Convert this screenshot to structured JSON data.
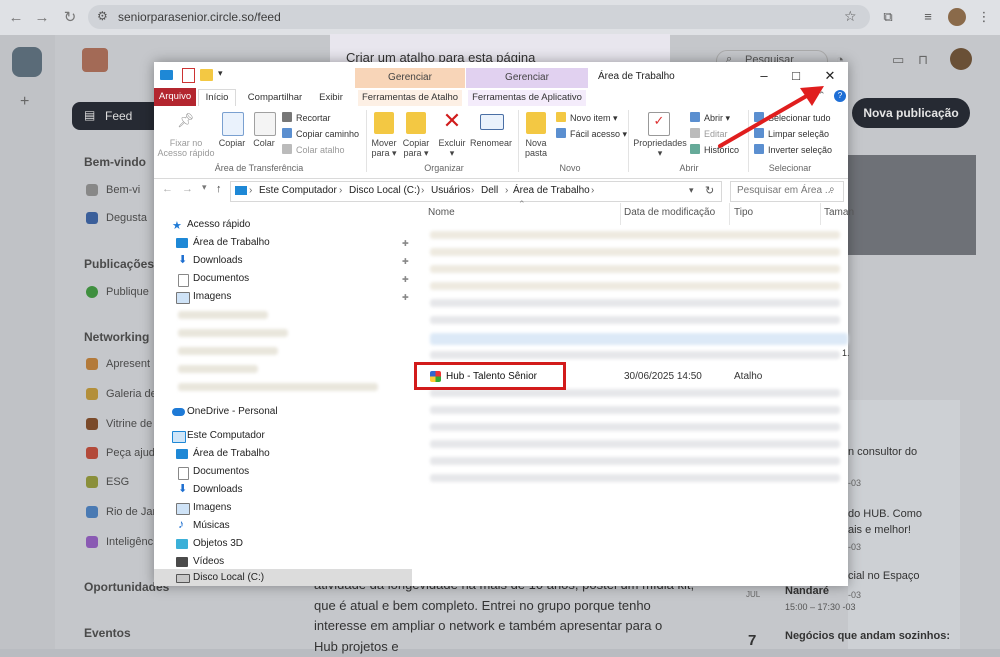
{
  "browser": {
    "url": "seniorparasenior.circle.so/feed"
  },
  "site": {
    "popup_title": "Criar um atalho para esta página",
    "search_placeholder": "Pesquisar",
    "new_post": "Nova publicação",
    "nav": {
      "feed": "Feed",
      "sections": [
        {
          "title": "Bem-vindo",
          "items": [
            "Bem-vi",
            "Degusta"
          ]
        },
        {
          "title": "Publicações",
          "items": [
            "Publique"
          ]
        },
        {
          "title": "Networking",
          "items": [
            "Apresent",
            "Galeria de",
            "Vitrine de",
            "Peça ajud",
            "ESG",
            "Rio de Jan",
            "Inteligênc"
          ]
        },
        {
          "title": "Oportunidades",
          "items": []
        },
        {
          "title": "Eventos",
          "items": []
        }
      ]
    },
    "post_text": [
      "atividade da longevidade há mais de 10 anos, postei um mídia kit,",
      "que é atual e bem completo. Entrei no grupo porque tenho",
      "interesse em ampliar o network e também apresentar para o",
      "Hub projetos e"
    ],
    "right_panel": {
      "lines": [
        "n consultor do",
        "-03",
        "do HUB. Como",
        "ais e melhor!",
        "-03",
        "cial no Espaço",
        "-03"
      ],
      "event_title": "Nandaré",
      "event_time": "15:00 – 17:30 -03",
      "event_month": "JUL",
      "event2_day": "7",
      "event2_title": "Negócios que andam sozinhos:"
    }
  },
  "explorer": {
    "window_title": "Área de Trabalho",
    "context_tabs": [
      {
        "group": "Gerenciar",
        "tab": "Ferramentas de Atalho"
      },
      {
        "group": "Gerenciar",
        "tab": "Ferramentas de Aplicativo"
      }
    ],
    "ribbon_tabs": [
      "Arquivo",
      "Início",
      "Compartilhar",
      "Exibir"
    ],
    "ribbon": {
      "clipboard": {
        "pin": "Fixar no Acesso rápido",
        "copy": "Copiar",
        "paste": "Colar",
        "cut": "Recortar",
        "copy_path": "Copiar caminho",
        "paste_shortcut": "Colar atalho",
        "group": "Área de Transferência"
      },
      "organize": {
        "move": "Mover para",
        "copy_to": "Copiar para",
        "delete": "Excluir",
        "rename": "Renomear",
        "group": "Organizar"
      },
      "new": {
        "new_folder": "Nova pasta",
        "new_item": "Novo item",
        "easy_access": "Fácil acesso",
        "group": "Novo"
      },
      "open": {
        "properties": "Propriedades",
        "open": "Abrir",
        "edit": "Editar",
        "history": "Histórico",
        "group": "Abrir"
      },
      "select": {
        "select_all": "Selecionar tudo",
        "select_none": "Limpar seleção",
        "invert": "Inverter seleção",
        "group": "Selecionar"
      }
    },
    "breadcrumb": [
      "Este Computador",
      "Disco Local (C:)",
      "Usuários",
      "Dell",
      "Área de Trabalho"
    ],
    "search_placeholder": "Pesquisar em Área ...",
    "nav_pane": {
      "quick_access": "Acesso rápido",
      "quick_items": [
        "Área de Trabalho",
        "Downloads",
        "Documentos",
        "Imagens"
      ],
      "onedrive": "OneDrive - Personal",
      "this_pc": "Este Computador",
      "pc_items": [
        "Área de Trabalho",
        "Documentos",
        "Downloads",
        "Imagens",
        "Músicas",
        "Objetos 3D",
        "Vídeos",
        "Disco Local (C:)"
      ]
    },
    "columns": [
      "Nome",
      "Data de modificação",
      "Tipo",
      "Taman"
    ],
    "file": {
      "name": "Hub - Talento Sênior",
      "date": "30/06/2025 14:50",
      "type": "Atalho"
    },
    "stray_digit": "1."
  }
}
